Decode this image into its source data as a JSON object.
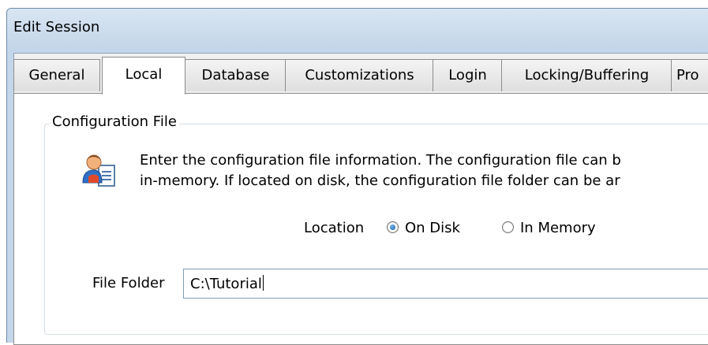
{
  "window": {
    "title": "Edit Session"
  },
  "tabs": [
    {
      "label": "General",
      "selected": false
    },
    {
      "label": "Local",
      "selected": true
    },
    {
      "label": "Database",
      "selected": false
    },
    {
      "label": "Customizations",
      "selected": false
    },
    {
      "label": "Login",
      "selected": false
    },
    {
      "label": "Locking/Buffering",
      "selected": false
    },
    {
      "label": "Pro",
      "selected": false
    }
  ],
  "config_group": {
    "label": "Configuration File",
    "icon": "user-document-icon",
    "description_line1": "Enter the configuration file information.  The configuration file can b",
    "description_line2": "in-memory.  If located on disk, the configuration file folder can be ar",
    "location": {
      "label": "Location",
      "options": [
        {
          "label": "On Disk",
          "checked": true
        },
        {
          "label": "In Memory",
          "checked": false
        }
      ]
    },
    "file_folder": {
      "label": "File Folder",
      "value": "C:\\Tutorial"
    }
  },
  "colors": {
    "title_bar": "#c4d6ea",
    "accent_radio": "#1b5fa6"
  }
}
